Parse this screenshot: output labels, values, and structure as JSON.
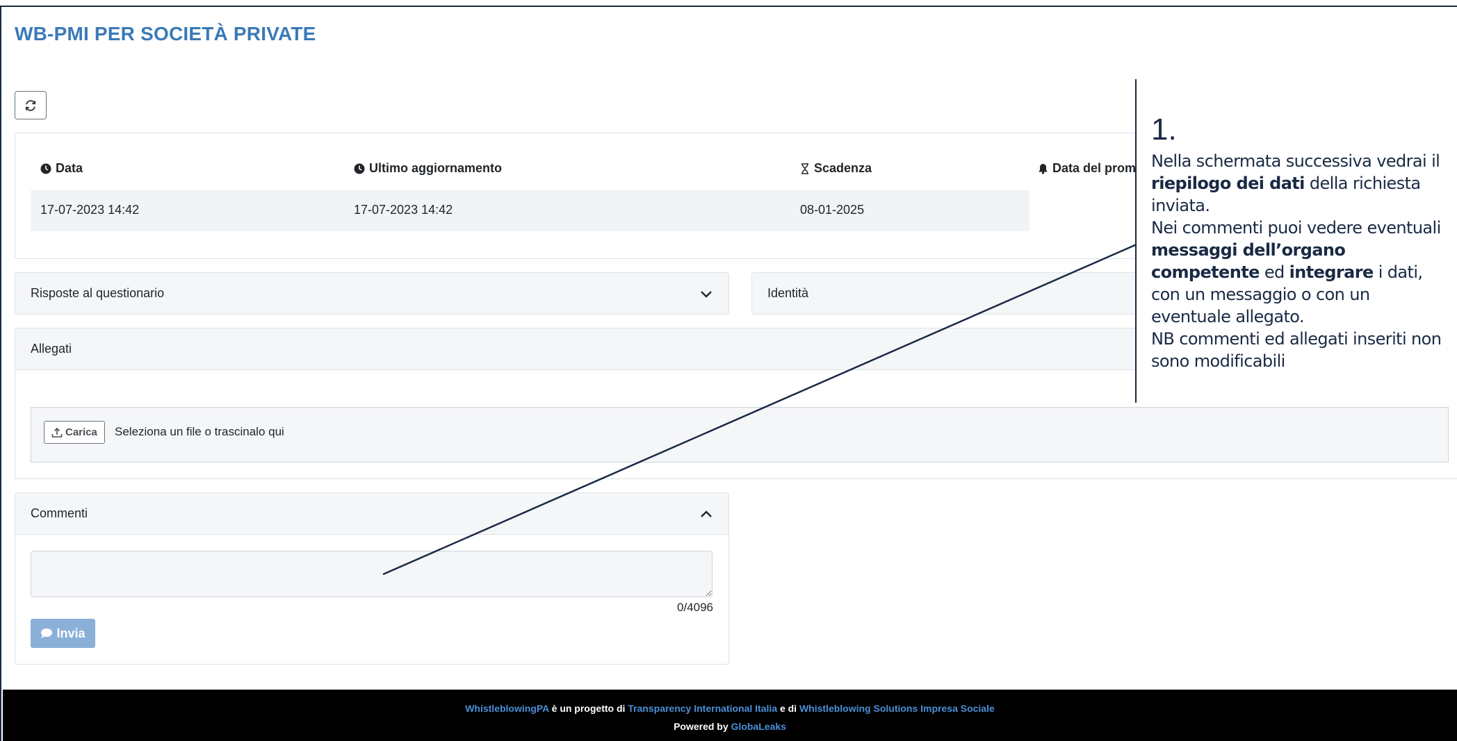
{
  "page": {
    "title": "WB-PMI PER SOCIETÀ PRIVATE"
  },
  "toolbar": {
    "refresh_icon": "refresh-icon"
  },
  "info": {
    "headers": [
      {
        "icon": "clock-icon",
        "label": "Data"
      },
      {
        "icon": "clock-icon",
        "label": "Ultimo aggiornamento"
      },
      {
        "icon": "hourglass-icon",
        "label": "Scadenza"
      },
      {
        "icon": "bell-icon",
        "label": "Data del prom"
      }
    ],
    "values": [
      "17-07-2023 14:42",
      "17-07-2023 14:42",
      "08-01-2025"
    ]
  },
  "panels": {
    "risposte": "Risposte al questionario",
    "identita": "Identità",
    "allegati": "Allegati",
    "commenti": "Commenti"
  },
  "upload": {
    "button_label": "Carica",
    "hint": "Seleziona un file o trascinalo qui"
  },
  "comment": {
    "counter": "0/4096",
    "send_label": "Invia",
    "placeholder": ""
  },
  "footer": {
    "project": "WhistleblowingPA",
    "text1": "è un progetto di",
    "org1": "Transparency International Italia",
    "text2": "e di",
    "org2": "Whistleblowing Solutions Impresa Sociale",
    "powered": "Powered by",
    "globaleaks": "GlobaLeaks"
  },
  "callout": {
    "number": "1.",
    "p1_a": "Nella schermata successiva vedrai il",
    "p1_b": "riepilogo dei dati",
    "p1_c": "della richiesta inviata.",
    "p2_a": "Nei commenti puoi vedere eventuali",
    "p2_b": "messaggi dell’organo competente",
    "p2_c": "ed",
    "p2_d": "integrare",
    "p2_e": "i dati, con un messaggio o con un eventuale allegato.",
    "p3": "NB commenti ed allegati inseriti non sono modificabili"
  },
  "colors": {
    "accent": "#3a7ab8",
    "footer_link": "#4a8fd6",
    "callout_text": "#1a2a44",
    "send_button": "#8ab0d8"
  }
}
